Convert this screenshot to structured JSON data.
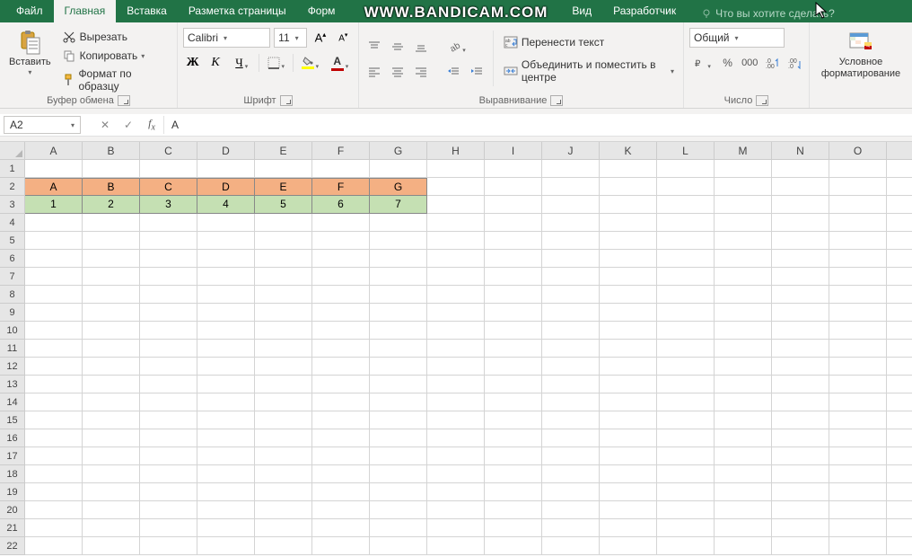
{
  "watermark": "WWW.BANDICAM.COM",
  "tabs": {
    "file": "Файл",
    "home": "Главная",
    "insert": "Вставка",
    "layout": "Разметка страницы",
    "formulas": "Форм",
    "view": "Вид",
    "developer": "Разработчик",
    "tell": "Что вы хотите сделать?"
  },
  "clipboard": {
    "paste": "Вставить",
    "cut": "Вырезать",
    "copy": "Копировать",
    "format_painter": "Формат по образцу",
    "group": "Буфер обмена"
  },
  "font": {
    "name": "Calibri",
    "size": "11",
    "bold": "Ж",
    "italic": "К",
    "underline": "Ч",
    "group": "Шрифт"
  },
  "align": {
    "wrap": "Перенести текст",
    "merge": "Объединить и поместить в центре",
    "group": "Выравнивание"
  },
  "number": {
    "format": "Общий",
    "group": "Число"
  },
  "cond": {
    "label1": "Условное",
    "label2": "форматирование"
  },
  "namebox": "A2",
  "formula": "A",
  "columns": [
    "A",
    "B",
    "C",
    "D",
    "E",
    "F",
    "G",
    "H",
    "I",
    "J",
    "K",
    "L",
    "M",
    "N",
    "O"
  ],
  "row_count": 22,
  "data_rows": [
    {
      "fill": "orange",
      "values": [
        "A",
        "B",
        "C",
        "D",
        "E",
        "F",
        "G"
      ]
    },
    {
      "fill": "green",
      "values": [
        "1",
        "2",
        "3",
        "4",
        "5",
        "6",
        "7"
      ]
    }
  ]
}
